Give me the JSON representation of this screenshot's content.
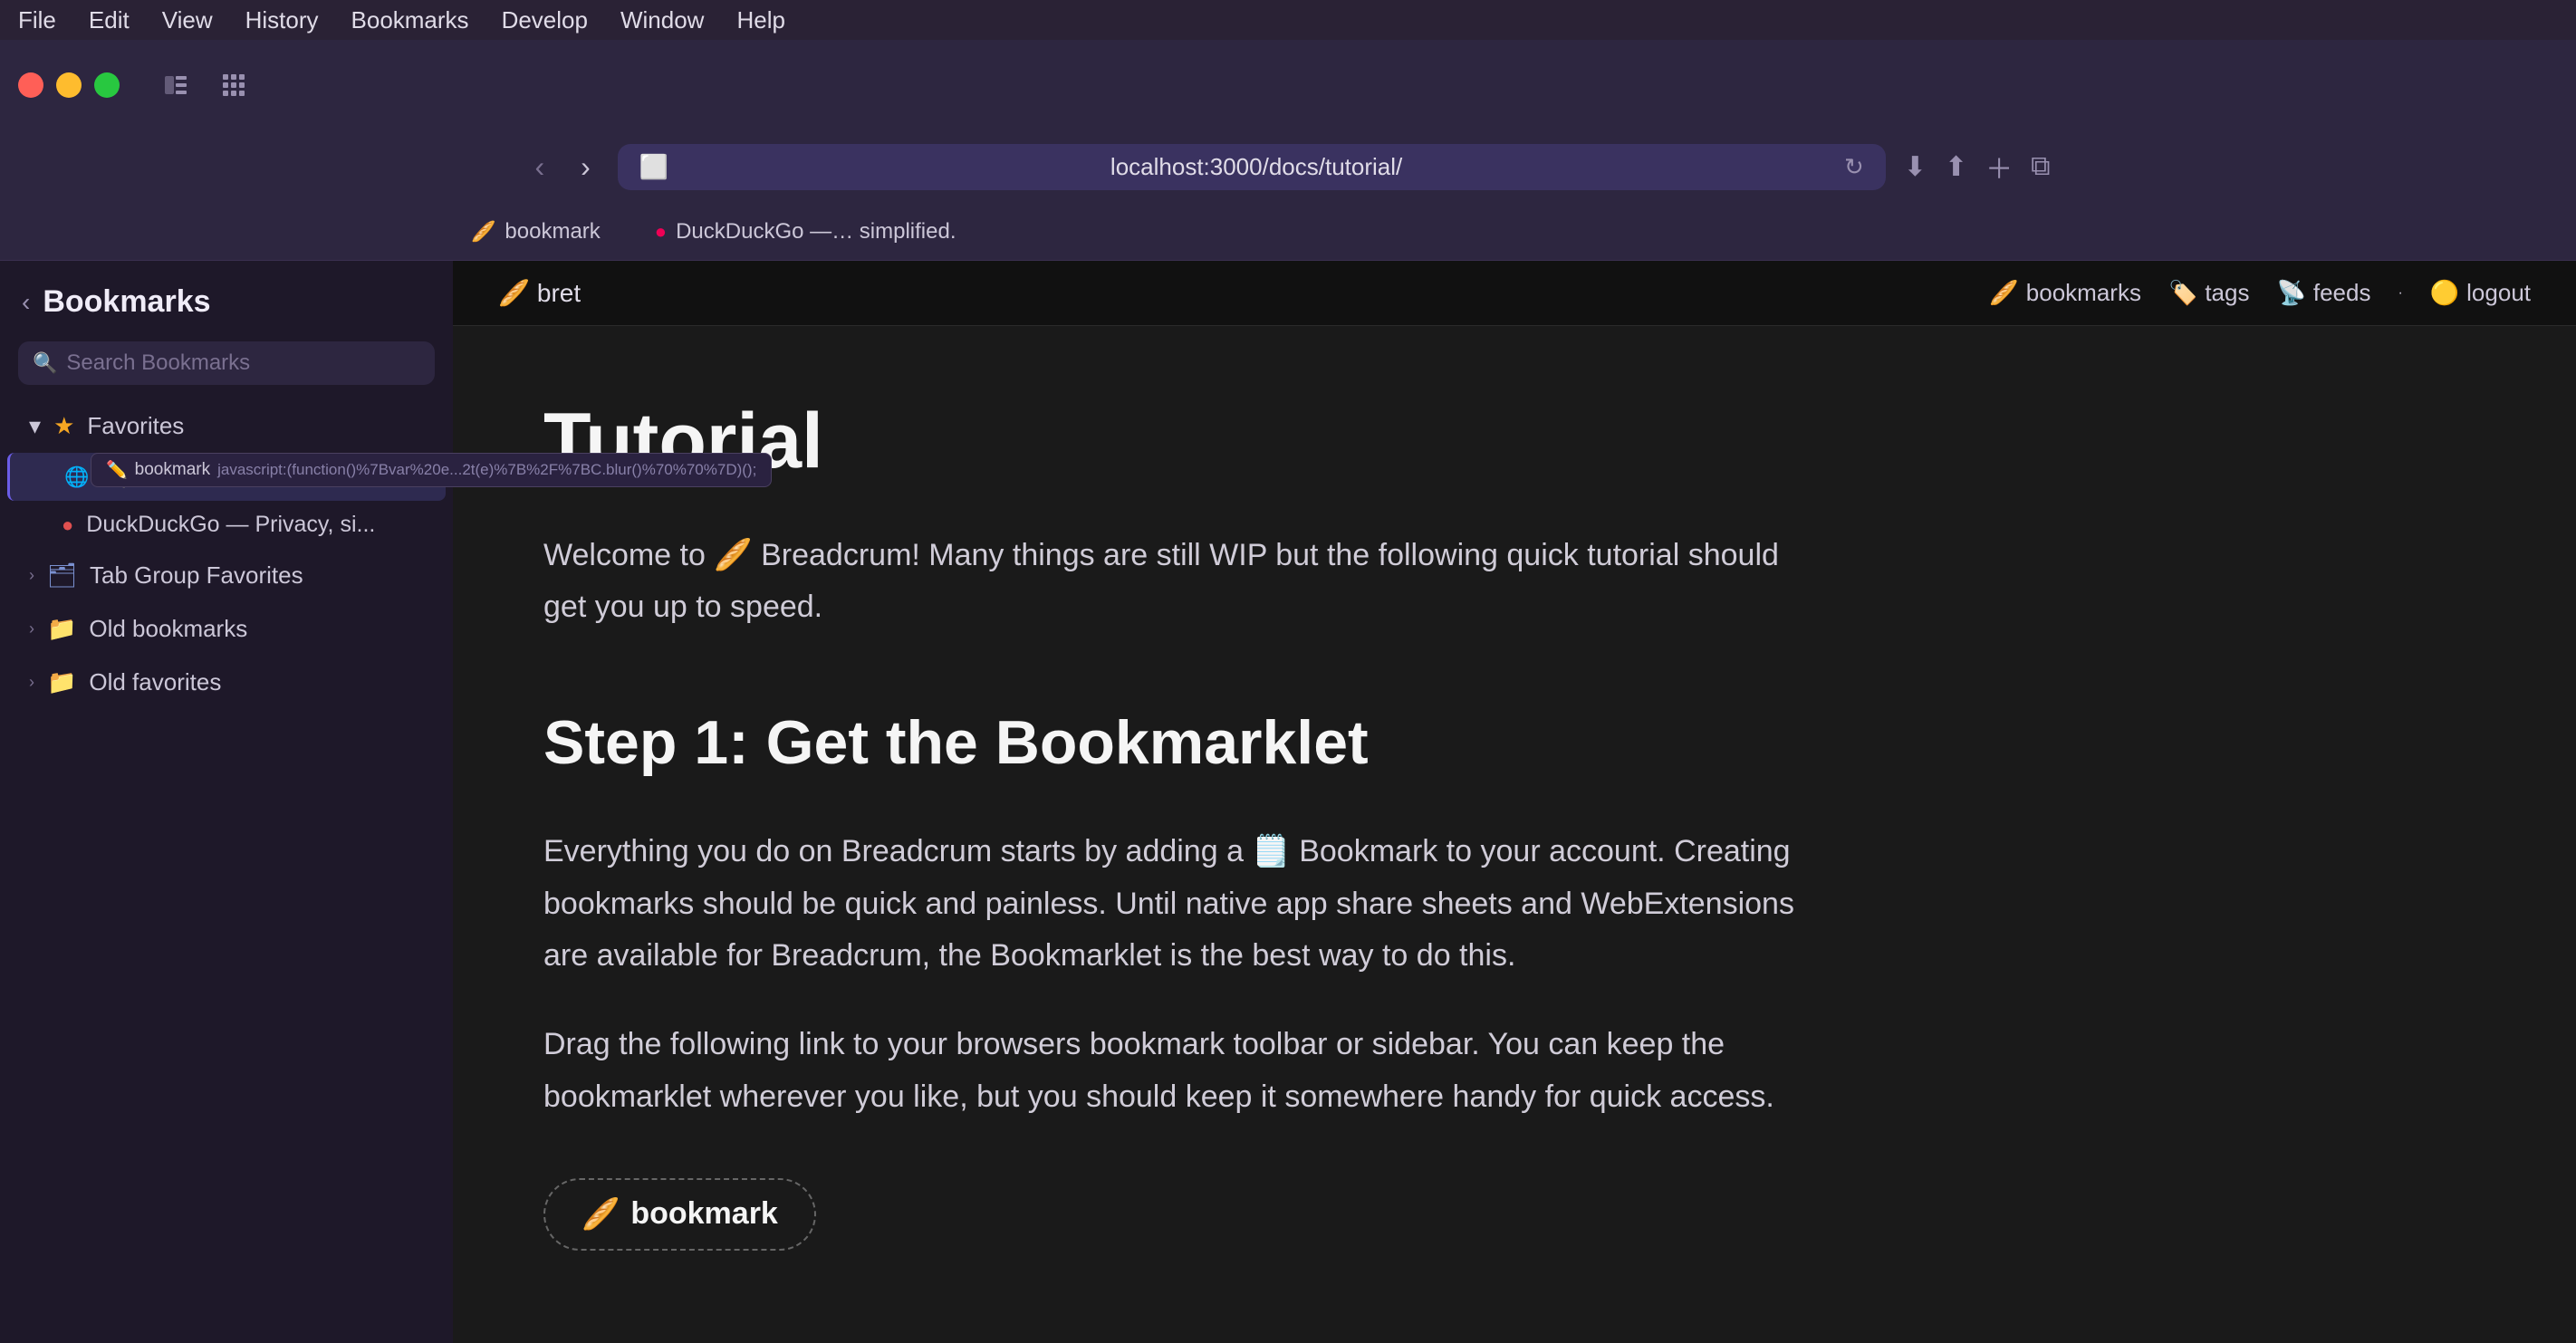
{
  "menubar": {
    "items": [
      "File",
      "Edit",
      "View",
      "History",
      "Bookmarks",
      "Develop",
      "Window",
      "Help"
    ]
  },
  "browser": {
    "url": "localhost:3000/docs/tutorial/",
    "tab1_emoji": "🥖",
    "tab1_label": "bookmark",
    "tab2_label": "DuckDuckGo —… simplified."
  },
  "sidebar": {
    "title": "Bookmarks",
    "search_placeholder": "Search Bookmarks",
    "favorites_label": "Favorites",
    "bookmark_label": "bookmark",
    "bookmark_tooltip": "bookmark",
    "bookmark_url_tooltip": "javascript:(function()%7Bvar%20e...2t(e)%7B%2F%7BC.blur()%70%70%7D)();",
    "duckduckgo_label": "DuckDuckGo — Privacy, si...",
    "tab_group_label": "Tab Group Favorites",
    "old_bookmarks_label": "Old bookmarks",
    "old_favorites_label": "Old favorites"
  },
  "app_header": {
    "user_emoji": "🥖",
    "user_label": "bret",
    "nav_bookmarks_emoji": "🥖",
    "nav_bookmarks_label": "bookmarks",
    "nav_tags_emoji": "🏷️",
    "nav_tags_label": "tags",
    "nav_feeds_emoji": "📡",
    "nav_feeds_label": "feeds",
    "nav_logout_emoji": "🟡",
    "nav_logout_label": "logout"
  },
  "tutorial": {
    "title": "Tutorial",
    "intro": "Welcome to 🥖 Breadcrum! Many things are still WIP but the following quick tutorial should get you up to speed.",
    "step1_title": "Step 1: Get the Bookmarklet",
    "step1_para1": "Everything you do on Breadcrum starts by adding a 🗒️ Bookmark to your account. Creating bookmarks should be quick and painless. Until native app share sheets and WebExtensions are available for Breadcrum, the Bookmarklet is the best way to do this.",
    "step1_para2": "Drag the following link to your browsers bookmark toolbar or sidebar. You can keep the bookmarklet wherever you like, but you should keep it somewhere handy for quick access.",
    "bookmarklet_emoji": "🥖",
    "bookmarklet_label": "bookmark"
  },
  "colors": {
    "sidebar_bg": "#1e1829",
    "content_bg": "#1a1a1a",
    "accent": "#6b5de8"
  }
}
